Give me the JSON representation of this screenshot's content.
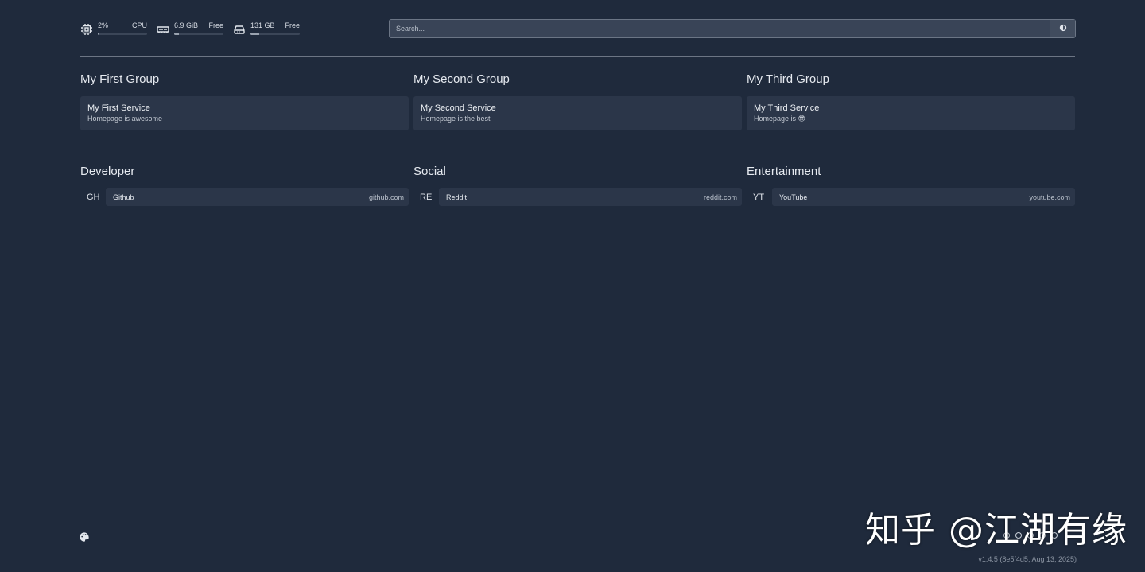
{
  "widgets": {
    "cpu": {
      "value": "2%",
      "label": "CPU",
      "percent": 2
    },
    "memory": {
      "value": "6.9 GiB",
      "label": "Free",
      "percent": 10
    },
    "disk": {
      "value": "131 GB",
      "label": "Free",
      "percent": 18
    }
  },
  "search": {
    "placeholder": "Search..."
  },
  "service_groups": [
    {
      "title": "My First Group",
      "service": {
        "name": "My First Service",
        "description": "Homepage is awesome"
      }
    },
    {
      "title": "My Second Group",
      "service": {
        "name": "My Second Service",
        "description": "Homepage is the best"
      }
    },
    {
      "title": "My Third Group",
      "service": {
        "name": "My Third Service",
        "description": "Homepage is 😎"
      }
    }
  ],
  "bookmark_groups": [
    {
      "title": "Developer",
      "bookmark": {
        "abbr": "GH",
        "name": "Github",
        "host": "github.com"
      }
    },
    {
      "title": "Social",
      "bookmark": {
        "abbr": "RE",
        "name": "Reddit",
        "host": "reddit.com"
      }
    },
    {
      "title": "Entertainment",
      "bookmark": {
        "abbr": "YT",
        "name": "YouTube",
        "host": "youtube.com"
      }
    }
  ],
  "footer": {
    "version": "v1.4.5 (8e5f4d5, Aug 13, 2025)"
  },
  "watermark": {
    "text": "知乎 @江湖有缘"
  },
  "colors": {
    "background": "#1f2a3c",
    "card": "#2b3649"
  }
}
